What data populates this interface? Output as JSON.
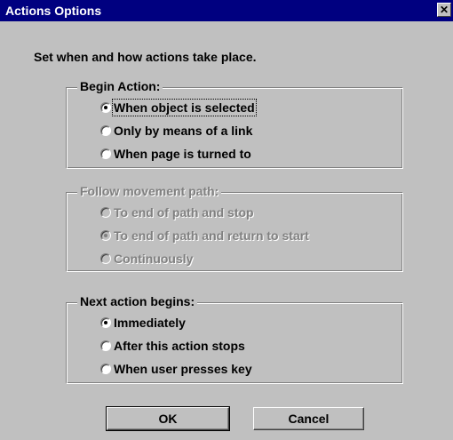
{
  "window": {
    "title": "Actions Options",
    "close_glyph": "✕"
  },
  "intro_text": "Set when and how actions take place.",
  "begin_action": {
    "legend": "Begin Action:",
    "options": [
      {
        "label": "When object is selected",
        "selected": true
      },
      {
        "label": "Only by means of a link",
        "selected": false
      },
      {
        "label": "When page is turned to",
        "selected": false
      }
    ]
  },
  "follow_path": {
    "legend": "Follow movement path:",
    "enabled": false,
    "options": [
      {
        "label": "To end of path and stop",
        "selected": false
      },
      {
        "label": "To end of path and return to start",
        "selected": true
      },
      {
        "label": "Continuously",
        "selected": false
      }
    ]
  },
  "next_action": {
    "legend": "Next action begins:",
    "options": [
      {
        "label": "Immediately",
        "selected": true
      },
      {
        "label": "After this action stops",
        "selected": false
      },
      {
        "label": "When user presses key",
        "selected": false
      }
    ]
  },
  "buttons": {
    "ok": "OK",
    "cancel": "Cancel"
  }
}
